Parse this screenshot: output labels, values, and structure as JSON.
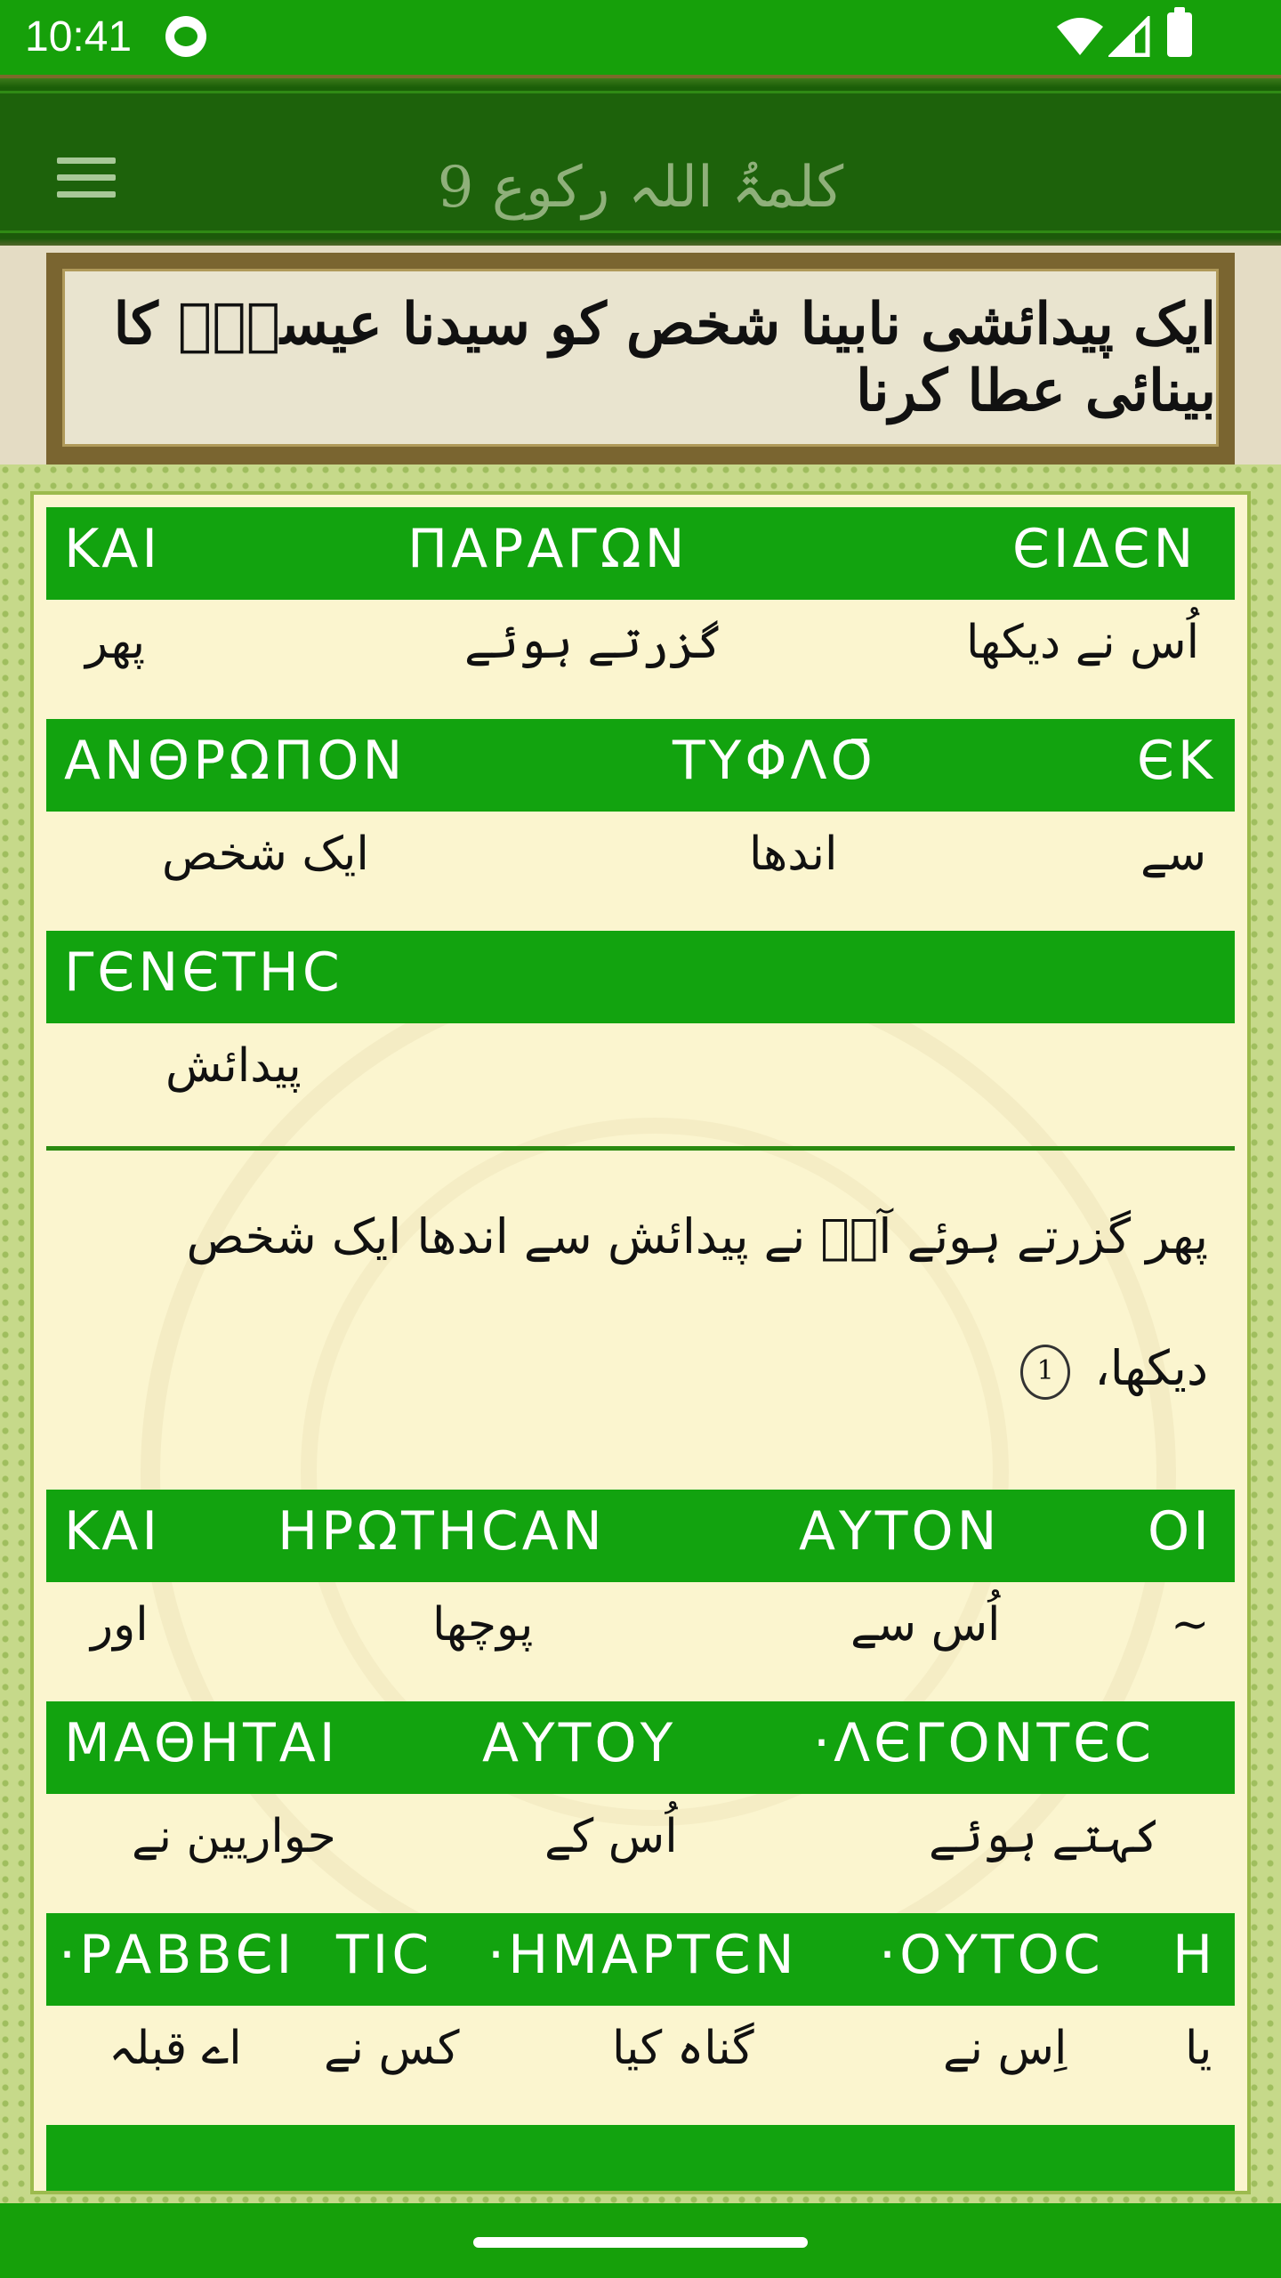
{
  "status_bar": {
    "time": "10:41"
  },
  "app_bar": {
    "title": "کلمۃُ اللہ رکوع 9"
  },
  "banner": {
    "heading": "ایک پیدائشی نابینا شخص کو سیدنا عیسیٰؑ کا بینائی عطا کرنا"
  },
  "verses": [
    {
      "greek": [
        "KAI",
        "ΠΑΡΑΓΩΝ",
        "ЄΙΔЄΝ"
      ],
      "urdu": [
        "پھر",
        "گزرتے ہوئے",
        "اُس نے دیکھا"
      ]
    },
    {
      "greek": [
        "ΑΝΘΡΩΠΟΝ",
        "ΤΥΦΛΟ̄",
        "ЄΚ"
      ],
      "urdu": [
        "ایک شخص",
        "اندھا",
        "سے"
      ]
    },
    {
      "greek": [
        "ΓЄΝЄΤΗC"
      ],
      "urdu": [
        "پیدائش"
      ]
    }
  ],
  "translation_1": {
    "line1": "پھر گزرتے ہوئے آپؑ نے پیدائش سے اندھا ایک شخص",
    "line2": "دیکھا،",
    "marker": "1"
  },
  "verses_2": [
    {
      "greek": [
        "KAI",
        "ΗΡΩΤΗCΑΝ",
        "ΑΥΤΟΝ",
        "ΟΙ"
      ],
      "urdu": [
        "اور",
        "پوچھا",
        "اُس سے",
        "~"
      ]
    },
    {
      "greek": [
        "ΜΑΘΗΤΑΙ",
        "ΑΥΤΟΥ",
        "·ΛЄΓΟΝΤЄC"
      ],
      "urdu": [
        "حواریین نے",
        "اُس کے",
        "کہتے ہوئے"
      ]
    },
    {
      "greek": [
        "·ΡΑΒΒЄΙ",
        "ΤΙC",
        "·ΗΜΑΡΤЄΝ",
        "·ΟΥΤΟC",
        "Η"
      ],
      "urdu": [
        "اے قبلہ",
        "کس نے",
        "گناہ کیا",
        "اِس نے",
        "یا"
      ]
    }
  ]
}
